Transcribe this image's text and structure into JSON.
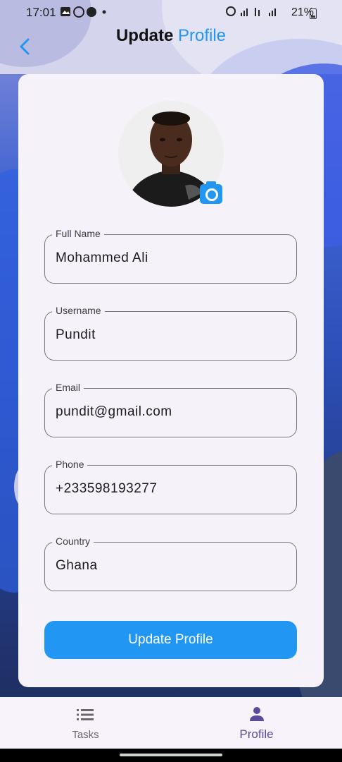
{
  "status_bar": {
    "time": "17:01",
    "right_text": "21%"
  },
  "header": {
    "title_part1": "Update",
    "title_part2": "Profile"
  },
  "form": {
    "fields": [
      {
        "label": "Full Name",
        "value": "Mohammed Ali"
      },
      {
        "label": "Username",
        "value": "Pundit"
      },
      {
        "label": "Email",
        "value": "pundit@gmail.com"
      },
      {
        "label": "Phone",
        "value": "+233598193277"
      },
      {
        "label": "Country",
        "value": "Ghana"
      }
    ],
    "submit_label": "Update Profile"
  },
  "bottom_nav": {
    "items": [
      {
        "label": "Tasks",
        "icon": "list-icon"
      },
      {
        "label": "Profile",
        "icon": "person-icon"
      }
    ]
  },
  "colors": {
    "accent": "#2196f3",
    "nav_active": "#5b4c9a"
  }
}
